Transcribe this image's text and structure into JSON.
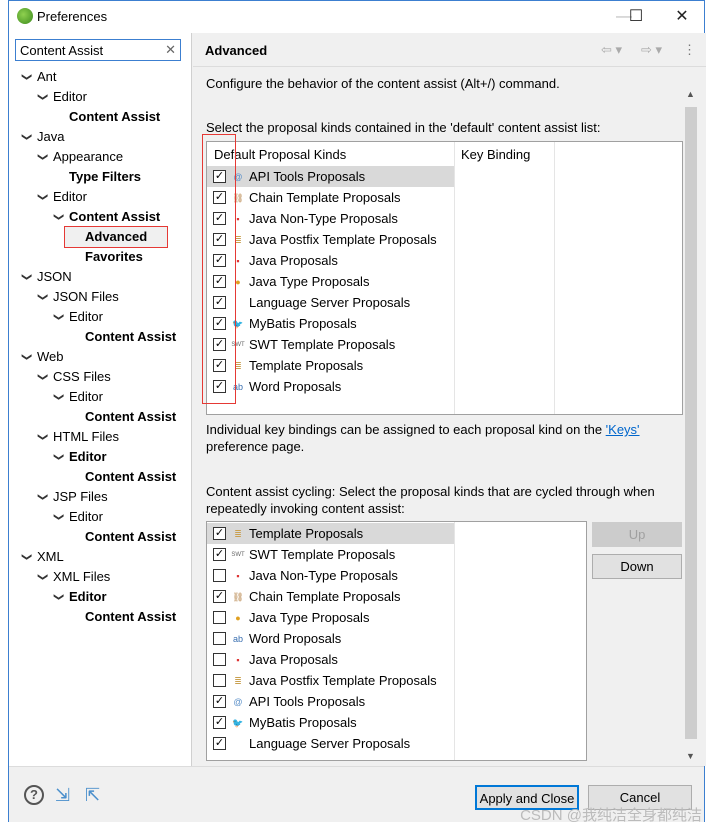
{
  "window": {
    "title": "Preferences",
    "minimize": "—",
    "maximize": "☐",
    "close": "✕"
  },
  "search": {
    "value": "Content Assist",
    "clear": "✕"
  },
  "tree": [
    {
      "label": "Ant",
      "level": 0,
      "chev": "open",
      "bold": false
    },
    {
      "label": "Editor",
      "level": 1,
      "chev": "open",
      "bold": false
    },
    {
      "label": "Content Assist",
      "level": 2,
      "chev": "none",
      "bold": true
    },
    {
      "label": "Java",
      "level": 0,
      "chev": "open",
      "bold": false
    },
    {
      "label": "Appearance",
      "level": 1,
      "chev": "open",
      "bold": false
    },
    {
      "label": "Type Filters",
      "level": 2,
      "chev": "none",
      "bold": true
    },
    {
      "label": "Editor",
      "level": 1,
      "chev": "open",
      "bold": false
    },
    {
      "label": "Content Assist",
      "level": 2,
      "chev": "open",
      "bold": true
    },
    {
      "label": "Advanced",
      "level": 3,
      "chev": "none",
      "bold": true,
      "selected": true
    },
    {
      "label": "Favorites",
      "level": 3,
      "chev": "none",
      "bold": true
    },
    {
      "label": "JSON",
      "level": 0,
      "chev": "open",
      "bold": false
    },
    {
      "label": "JSON Files",
      "level": 1,
      "chev": "open",
      "bold": false
    },
    {
      "label": "Editor",
      "level": 2,
      "chev": "open",
      "bold": false
    },
    {
      "label": "Content Assist",
      "level": 3,
      "chev": "none",
      "bold": true
    },
    {
      "label": "Web",
      "level": 0,
      "chev": "open",
      "bold": false
    },
    {
      "label": "CSS Files",
      "level": 1,
      "chev": "open",
      "bold": false
    },
    {
      "label": "Editor",
      "level": 2,
      "chev": "open",
      "bold": false
    },
    {
      "label": "Content Assist",
      "level": 3,
      "chev": "none",
      "bold": true
    },
    {
      "label": "HTML Files",
      "level": 1,
      "chev": "open",
      "bold": false
    },
    {
      "label": "Editor",
      "level": 2,
      "chev": "open",
      "bold": true
    },
    {
      "label": "Content Assist",
      "level": 3,
      "chev": "none",
      "bold": true
    },
    {
      "label": "JSP Files",
      "level": 1,
      "chev": "open",
      "bold": false
    },
    {
      "label": "Editor",
      "level": 2,
      "chev": "open",
      "bold": false
    },
    {
      "label": "Content Assist",
      "level": 3,
      "chev": "none",
      "bold": true
    },
    {
      "label": "XML",
      "level": 0,
      "chev": "open",
      "bold": false
    },
    {
      "label": "XML Files",
      "level": 1,
      "chev": "open",
      "bold": false
    },
    {
      "label": "Editor",
      "level": 2,
      "chev": "open",
      "bold": true
    },
    {
      "label": "Content Assist",
      "level": 3,
      "chev": "none",
      "bold": true
    }
  ],
  "page": {
    "title": "Advanced",
    "description": "Configure the behavior of the content assist (Alt+/) command.",
    "default_label": "Select the proposal kinds contained in the 'default' content assist list:",
    "columns": [
      "Default Proposal Kinds",
      "Key Binding"
    ],
    "default_kinds": [
      {
        "label": "API Tools Proposals",
        "checked": true,
        "icon": "api-tools"
      },
      {
        "label": "Chain Template Proposals",
        "checked": true,
        "icon": "chain-template"
      },
      {
        "label": "Java Non-Type Proposals",
        "checked": true,
        "icon": "java-non-type"
      },
      {
        "label": "Java Postfix Template Proposals",
        "checked": true,
        "icon": "template"
      },
      {
        "label": "Java Proposals",
        "checked": true,
        "icon": "java-non-type"
      },
      {
        "label": "Java Type Proposals",
        "checked": true,
        "icon": "java-type"
      },
      {
        "label": "Language Server Proposals",
        "checked": true,
        "icon": "none"
      },
      {
        "label": "MyBatis Proposals",
        "checked": true,
        "icon": "mybatis"
      },
      {
        "label": "SWT Template Proposals",
        "checked": true,
        "icon": "swt"
      },
      {
        "label": "Template Proposals",
        "checked": true,
        "icon": "template"
      },
      {
        "label": "Word Proposals",
        "checked": true,
        "icon": "word"
      }
    ],
    "keys_text_pre": "Individual key bindings can be assigned to each proposal kind on the ",
    "keys_link": "'Keys'",
    "keys_text_post": "preference page.",
    "cycling_line1": "Content assist cycling: Select the proposal kinds that are cycled through when",
    "cycling_line2": "repeatedly invoking content assist:",
    "cycling_kinds": [
      {
        "label": "Template Proposals",
        "checked": true,
        "icon": "template"
      },
      {
        "label": "SWT Template Proposals",
        "checked": true,
        "icon": "swt"
      },
      {
        "label": "Java Non-Type Proposals",
        "checked": false,
        "icon": "java-non-type"
      },
      {
        "label": "Chain Template Proposals",
        "checked": true,
        "icon": "chain-template"
      },
      {
        "label": "Java Type Proposals",
        "checked": false,
        "icon": "java-type"
      },
      {
        "label": "Word Proposals",
        "checked": false,
        "icon": "word"
      },
      {
        "label": "Java Proposals",
        "checked": false,
        "icon": "java-non-type"
      },
      {
        "label": "Java Postfix Template Proposals",
        "checked": false,
        "icon": "template"
      },
      {
        "label": "API Tools Proposals",
        "checked": true,
        "icon": "api-tools"
      },
      {
        "label": "MyBatis Proposals",
        "checked": true,
        "icon": "mybatis"
      },
      {
        "label": "Language Server Proposals",
        "checked": true,
        "icon": "none"
      }
    ],
    "up": "Up",
    "down": "Down"
  },
  "footer": {
    "apply_close": "Apply and Close",
    "cancel": "Cancel"
  },
  "watermark": "CSDN @我纯洁全身都纯洁",
  "colors": {
    "accent": "#3c7fd0",
    "highlight_box": "#e53935",
    "link": "#0066cc"
  }
}
